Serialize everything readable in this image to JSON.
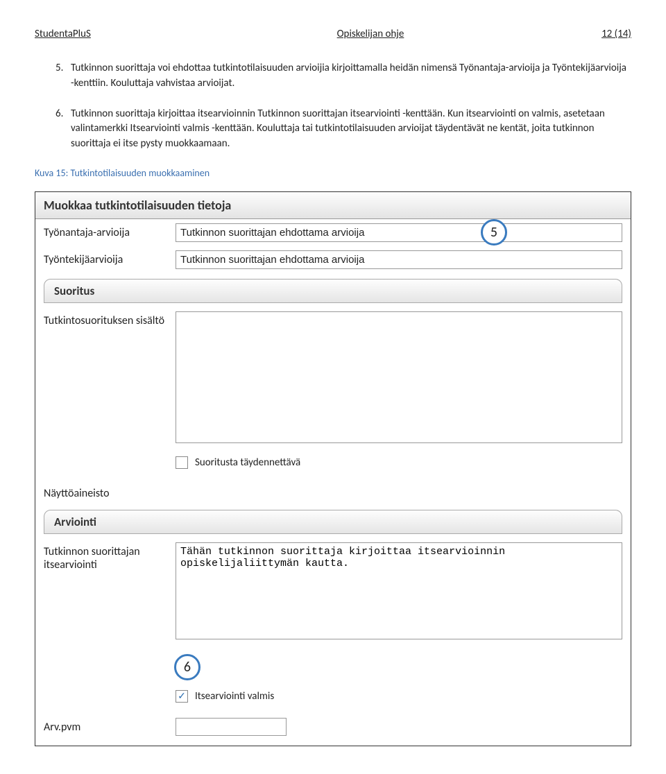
{
  "header": {
    "left": "StudentaPluS",
    "center": "Opiskelijan ohje",
    "right": "12 (14)"
  },
  "steps": {
    "s5_num": "5.",
    "s5_text": "Tutkinnon suorittaja voi ehdottaa tutkintotilaisuuden arvioijia kirjoittamalla heidän nimensä Työnantaja-arvioija ja Työntekijäarvioija -kenttiin. Kouluttaja vahvistaa arvioijat.",
    "s6_num": "6.",
    "s6_text": "Tutkinnon suorittaja kirjoittaa itsearvioinnin Tutkinnon suorittajan itsearviointi -kenttään. Kun itsearviointi on valmis, asetetaan valintamerkki Itsearviointi valmis -kenttään. Kouluttaja tai tutkintotilaisuuden arvioijat täydentävät ne kentät, joita tutkinnon suorittaja ei itse pysty muokkaamaan."
  },
  "caption": "Kuva 15: Tutkintotilaisuuden muokkaaminen",
  "form": {
    "title": "Muokkaa tutkintotilaisuuden tietoja",
    "employer_reviewer_label": "Työnantaja-arvioija",
    "employer_reviewer_value": "Tutkinnon suorittajan ehdottama arvioija",
    "employee_reviewer_label": "Työntekijäarvioija",
    "employee_reviewer_value": "Tutkinnon suorittajan ehdottama arvioija",
    "section_suoritus": "Suoritus",
    "content_label": "Tutkintosuorituksen sisältö",
    "content_value": "",
    "supplement_label": "Suoritusta täydennettävä",
    "material_label": "Näyttöaineisto",
    "section_arviointi": "Arviointi",
    "selfeval_label": "Tutkinnon suorittajan itsearviointi",
    "selfeval_value": "Tähän tutkinnon suorittaja kirjoittaa itsearvioinnin opiskelijaliittymän kautta.",
    "selfeval_done_label": "Itsearviointi valmis",
    "date_label": "Arv.pvm"
  },
  "badges": {
    "b5": "5",
    "b6": "6"
  }
}
